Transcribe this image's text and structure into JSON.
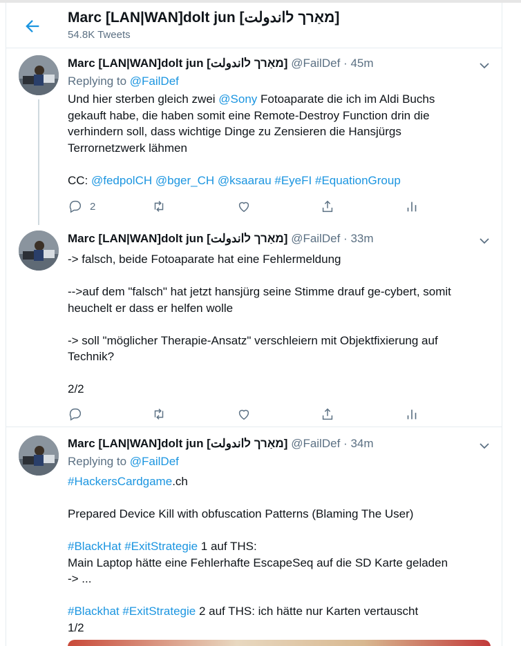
{
  "header": {
    "title": "Marc [LAN|WAN]dolt jun [מאַרך לاندولت]",
    "tweet_count": "54.8K Tweets"
  },
  "tweets": [
    {
      "name": "Marc [LAN|WAN]dolt jun [מאַרך לاندولت]",
      "handle": "@FailDef",
      "dot": "·",
      "time": "45m",
      "replying_prefix": "Replying to ",
      "replying_handle": "@FailDef",
      "text": {
        "l1a": "Und hier sterben gleich zwei ",
        "l1_mention": "@Sony",
        "l1b": " Fotoaparate die ich im Aldi Buchs",
        "l2": "gekauft habe, die haben somit eine Remote-Destroy Function drin die",
        "l3": "verhindern soll, dass wichtige Dinge zu Zensieren die Hansjürgs",
        "l4": "Terrornetzwerk lähmen",
        "cc": "CC: ",
        "m1": "@fedpolCH",
        "m2": "@bger_CH",
        "m3": "@ksaarau",
        "h1": "#EyeFI",
        "h2": "#EquationGroup"
      },
      "reply_count": "2"
    },
    {
      "name": "Marc [LAN|WAN]dolt jun [מאַרך לاندولت]",
      "handle": "@FailDef",
      "dot": "·",
      "time": "33m",
      "text": {
        "l1": "-> falsch, beide Fotoaparate hat eine Fehlermeldung",
        "l2": "-->auf dem \"falsch\" hat jetzt hansjürg seine Stimme drauf ge-cybert, somit",
        "l3": "heuchelt er dass er helfen wolle",
        "l4": "-> soll \"möglicher Therapie-Ansatz\" verschleiern mit Objektfixierung auf",
        "l5": "Technik?",
        "l6": "2/2"
      }
    },
    {
      "name": "Marc [LAN|WAN]dolt jun [מאַרך לاندولت]",
      "handle": "@FailDef",
      "dot": "·",
      "time": "34m",
      "replying_prefix": "Replying to ",
      "replying_handle": "@FailDef",
      "text": {
        "h_cardgame": "#HackersCardgame",
        "l1_suffix": ".ch",
        "l2": "Prepared Device Kill with obfuscation Patterns (Blaming The User)",
        "h_blackhat": "#BlackHat",
        "h_exit1": "#ExitStrategie",
        "l3_suffix": " 1 auf THS:",
        "l4": "Main Laptop hätte eine Fehlerhafte EscapeSeq auf die SD Karte geladen",
        "l5": "-> ...",
        "h_blackhat2": "#Blackhat",
        "h_exit2": "#ExitStrategie",
        "l6_suffix": " 2 auf THS: ich hätte nur Karten vertauscht",
        "l7": "1/2"
      }
    }
  ],
  "colors": {
    "accent": "#1b95e0",
    "secondary_text": "#5b7083",
    "border": "#e6ecf0"
  },
  "icons": [
    "back-arrow-icon",
    "chevron-down-icon",
    "reply-icon",
    "retweet-icon",
    "like-icon",
    "share-icon",
    "analytics-icon"
  ]
}
